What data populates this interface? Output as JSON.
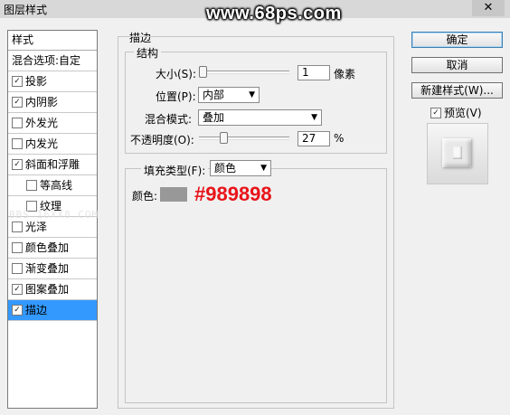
{
  "window": {
    "title": "图层样式",
    "watermark": "www.68ps.com",
    "close_glyph": "✕"
  },
  "left_panel": {
    "header": "样式",
    "items": [
      {
        "label": "混合选项:自定",
        "checkbox": false,
        "checked": false,
        "sub": false,
        "selected": false
      },
      {
        "label": "投影",
        "checkbox": true,
        "checked": true,
        "sub": false,
        "selected": false
      },
      {
        "label": "内阴影",
        "checkbox": true,
        "checked": true,
        "sub": false,
        "selected": false
      },
      {
        "label": "外发光",
        "checkbox": true,
        "checked": false,
        "sub": false,
        "selected": false
      },
      {
        "label": "内发光",
        "checkbox": true,
        "checked": false,
        "sub": false,
        "selected": false
      },
      {
        "label": "斜面和浮雕",
        "checkbox": true,
        "checked": true,
        "sub": false,
        "selected": false
      },
      {
        "label": "等高线",
        "checkbox": true,
        "checked": false,
        "sub": true,
        "selected": false
      },
      {
        "label": "纹理",
        "checkbox": true,
        "checked": false,
        "sub": true,
        "selected": false
      },
      {
        "label": "光泽",
        "checkbox": true,
        "checked": false,
        "sub": false,
        "selected": false
      },
      {
        "label": "颜色叠加",
        "checkbox": true,
        "checked": false,
        "sub": false,
        "selected": false
      },
      {
        "label": "渐变叠加",
        "checkbox": true,
        "checked": false,
        "sub": false,
        "selected": false
      },
      {
        "label": "图案叠加",
        "checkbox": true,
        "checked": true,
        "sub": false,
        "selected": false
      },
      {
        "label": "描边",
        "checkbox": true,
        "checked": true,
        "sub": false,
        "selected": true
      }
    ]
  },
  "stroke": {
    "section_title": "描边",
    "structure_title": "结构",
    "size_label": "大小(S):",
    "size_value": "1",
    "size_unit": "像素",
    "size_level": 0.0,
    "position_label": "位置(P):",
    "position_value": "内部",
    "blend_label": "混合模式:",
    "blend_value": "叠加",
    "opacity_label": "不透明度(O):",
    "opacity_value": "27",
    "opacity_unit": "%",
    "opacity_level": 0.27,
    "fill_type_label": "填充类型(F):",
    "fill_type_value": "颜色",
    "color_label": "颜色:",
    "color_hex": "#989898",
    "color_hex_text": "#989898"
  },
  "buttons": {
    "ok": "确定",
    "cancel": "取消",
    "new_style": "新建样式(W)...",
    "preview_label": "预览(V)",
    "preview_checked": true
  },
  "overlay_watermark": "BBS.16XX8.COM"
}
